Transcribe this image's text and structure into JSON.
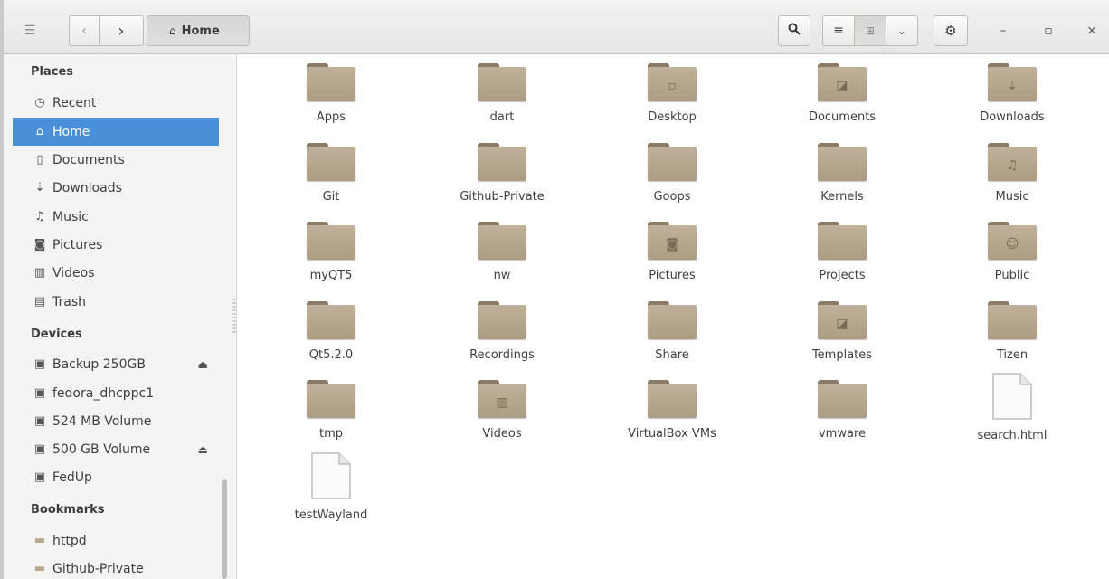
{
  "headerbar": {
    "menu_icon": "sidebar-toggle-icon",
    "back_icon": "chevron-left-icon",
    "forward_icon": "chevron-right-icon",
    "path_label": "Home",
    "path_icon": "home-icon",
    "search_icon": "search-icon",
    "list_view_icon": "list-view-icon",
    "grid_view_icon": "grid-view-icon",
    "view_menu_icon": "chevron-down-icon",
    "gear_icon": "gear-icon",
    "minimize_glyph": "–",
    "maximize_glyph": "▫",
    "close_glyph": "×"
  },
  "sidebar": {
    "sections": [
      {
        "heading": "Places",
        "items": [
          {
            "label": "Recent",
            "icon": "clock-icon",
            "glyph": "◷",
            "active": false
          },
          {
            "label": "Home",
            "icon": "home-icon",
            "glyph": "⌂",
            "active": true
          },
          {
            "label": "Documents",
            "icon": "document-icon",
            "glyph": "▯",
            "active": false
          },
          {
            "label": "Downloads",
            "icon": "download-icon",
            "glyph": "⇣",
            "active": false
          },
          {
            "label": "Music",
            "icon": "music-icon",
            "glyph": "♫",
            "active": false
          },
          {
            "label": "Pictures",
            "icon": "camera-icon",
            "glyph": "◙",
            "active": false
          },
          {
            "label": "Videos",
            "icon": "film-icon",
            "glyph": "▥",
            "active": false
          },
          {
            "label": "Trash",
            "icon": "trash-icon",
            "glyph": "▤",
            "active": false
          }
        ]
      },
      {
        "heading": "Devices",
        "items": [
          {
            "label": "Backup 250GB",
            "icon": "drive-icon",
            "glyph": "▣",
            "eject": true
          },
          {
            "label": "fedora_dhcppc1",
            "icon": "drive-icon",
            "glyph": "▣",
            "eject": false
          },
          {
            "label": "524 MB Volume",
            "icon": "drive-icon",
            "glyph": "▣",
            "eject": false
          },
          {
            "label": "500 GB Volume",
            "icon": "drive-icon",
            "glyph": "▣",
            "eject": true
          },
          {
            "label": "FedUp",
            "icon": "drive-icon",
            "glyph": "▣",
            "eject": false
          }
        ]
      },
      {
        "heading": "Bookmarks",
        "items": [
          {
            "label": "httpd",
            "icon": "folder-icon",
            "glyph": "▬",
            "eject": false
          },
          {
            "label": "Github-Private",
            "icon": "folder-icon",
            "glyph": "▬",
            "eject": false
          }
        ]
      }
    ],
    "eject_glyph": "⏏"
  },
  "files": [
    {
      "name": "Apps",
      "type": "folder",
      "emblem": ""
    },
    {
      "name": "dart",
      "type": "folder",
      "emblem": ""
    },
    {
      "name": "Desktop",
      "type": "folder",
      "emblem": "▫"
    },
    {
      "name": "Documents",
      "type": "folder",
      "emblem": "◪"
    },
    {
      "name": "Downloads",
      "type": "folder",
      "emblem": "⇣"
    },
    {
      "name": "Git",
      "type": "folder",
      "emblem": ""
    },
    {
      "name": "Github-Private",
      "type": "folder",
      "emblem": ""
    },
    {
      "name": "Goops",
      "type": "folder",
      "emblem": ""
    },
    {
      "name": "Kernels",
      "type": "folder",
      "emblem": ""
    },
    {
      "name": "Music",
      "type": "folder",
      "emblem": "♫"
    },
    {
      "name": "myQT5",
      "type": "folder",
      "emblem": ""
    },
    {
      "name": "nw",
      "type": "folder",
      "emblem": ""
    },
    {
      "name": "Pictures",
      "type": "folder",
      "emblem": "◙"
    },
    {
      "name": "Projects",
      "type": "folder",
      "emblem": ""
    },
    {
      "name": "Public",
      "type": "folder",
      "emblem": "☺"
    },
    {
      "name": "Qt5.2.0",
      "type": "folder",
      "emblem": ""
    },
    {
      "name": "Recordings",
      "type": "folder",
      "emblem": ""
    },
    {
      "name": "Share",
      "type": "folder",
      "emblem": ""
    },
    {
      "name": "Templates",
      "type": "folder",
      "emblem": "◪"
    },
    {
      "name": "Tizen",
      "type": "folder",
      "emblem": ""
    },
    {
      "name": "tmp",
      "type": "folder",
      "emblem": ""
    },
    {
      "name": "Videos",
      "type": "folder",
      "emblem": "▥"
    },
    {
      "name": "VirtualBox VMs",
      "type": "folder",
      "emblem": ""
    },
    {
      "name": "vmware",
      "type": "folder",
      "emblem": ""
    },
    {
      "name": "search.html",
      "type": "document",
      "emblem": ""
    },
    {
      "name": "testWayland",
      "type": "document",
      "emblem": ""
    }
  ],
  "colors": {
    "accent": "#4a90d9",
    "folder": "#b7a78e",
    "folder_tab": "#8a7b66"
  }
}
